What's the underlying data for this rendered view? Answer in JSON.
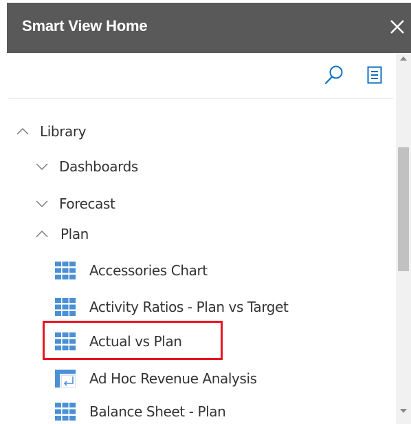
{
  "header": {
    "title": "Smart View Home",
    "close_icon": "close-icon"
  },
  "toolbar": {
    "search_icon": "search-icon",
    "list_icon": "list-view-icon"
  },
  "tree": {
    "library": {
      "label": "Library",
      "expanded": true
    },
    "folders": [
      {
        "label": "Dashboards",
        "expanded": false
      },
      {
        "label": "Forecast",
        "expanded": false
      },
      {
        "label": "Plan",
        "expanded": true
      }
    ],
    "plan_items": [
      {
        "label": "Accessories Chart",
        "icon": "form-grid-icon"
      },
      {
        "label": "Activity Ratios - Plan vs Target",
        "icon": "form-grid-icon"
      },
      {
        "label": "Actual vs Plan",
        "icon": "form-grid-icon",
        "highlighted": true
      },
      {
        "label": "Ad Hoc Revenue Analysis",
        "icon": "adhoc-grid-icon"
      },
      {
        "label": "Balance Sheet - Plan",
        "icon": "form-grid-icon"
      }
    ]
  },
  "colors": {
    "header_bg": "#595959",
    "accent_blue": "#0b6ec2",
    "grid_icon_blue": "#4b8fd4",
    "highlight_red": "#e8141e"
  }
}
